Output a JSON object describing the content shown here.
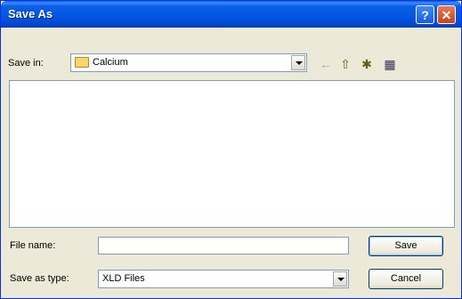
{
  "window": {
    "title": "Save As"
  },
  "titlebar": {
    "help_glyph": "?",
    "close_glyph": "✕"
  },
  "save_in": {
    "label": "Save in:",
    "value": "Calcium"
  },
  "toolbar": {
    "back_icon": "←",
    "up_icon": "⇧",
    "new_folder_icon": "✱",
    "views_icon": "▦"
  },
  "file_name": {
    "label": "File name:",
    "value": ""
  },
  "save_as_type": {
    "label": "Save as type:",
    "value": "XLD Files"
  },
  "buttons": {
    "save": "Save",
    "cancel": "Cancel"
  },
  "colors": {
    "titlebar": "#0a5fe6",
    "dialog_bg": "#ece9d8",
    "border": "#7f9db9"
  }
}
